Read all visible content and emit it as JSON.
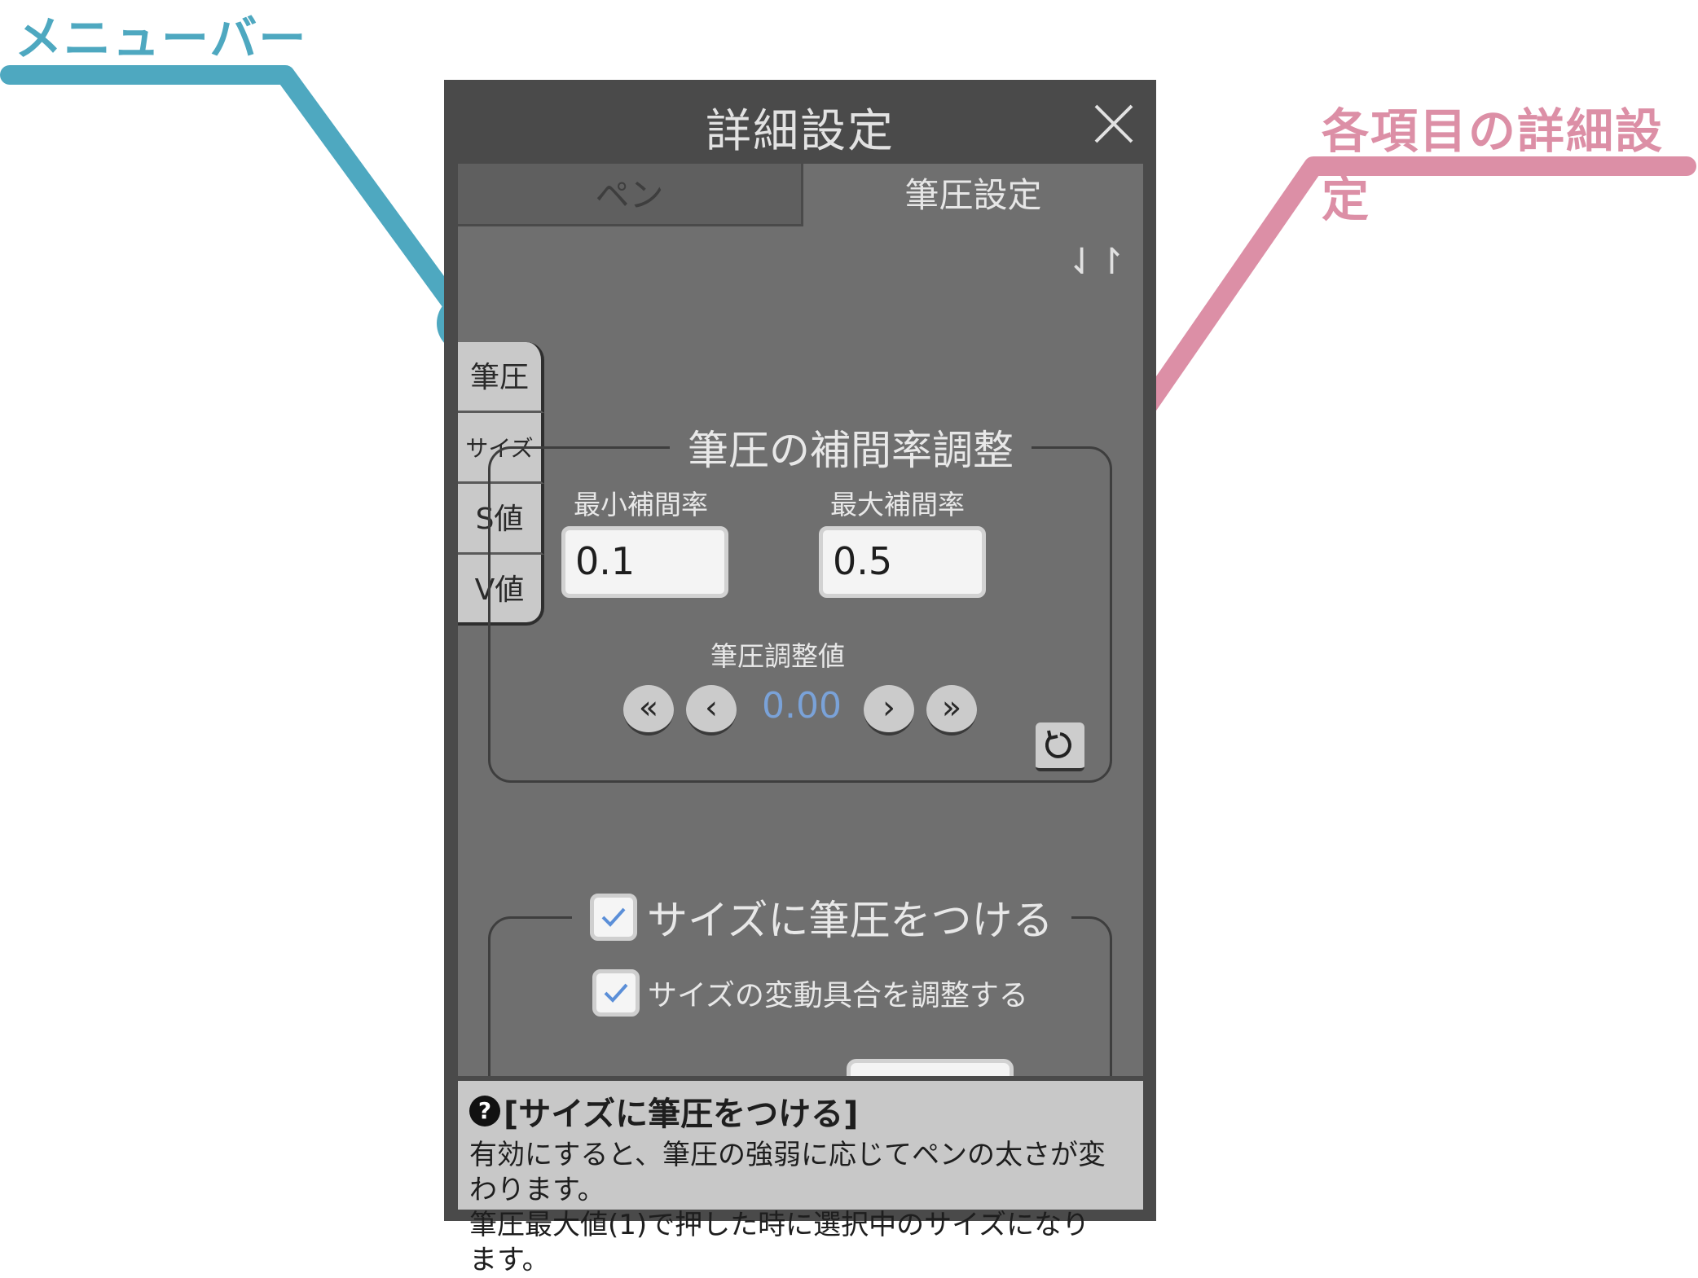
{
  "annotations": {
    "menubar_label": "メニューバー",
    "detail_label": "各項目の詳細設定",
    "menubar_color": "#4ea8c0",
    "detail_color": "#dc8fa6"
  },
  "dialog": {
    "title": "詳細設定",
    "close_icon": "close-icon",
    "tabs": [
      {
        "label": "ペン",
        "active": false
      },
      {
        "label": "筆圧設定",
        "active": true
      }
    ],
    "sort_icon": "⇃↾"
  },
  "side_menu": {
    "items": [
      {
        "label": "筆圧"
      },
      {
        "label": "サイズ"
      },
      {
        "label": "S値"
      },
      {
        "label": "V値"
      }
    ]
  },
  "pressure_group": {
    "title": "筆圧の補間率調整",
    "min_label": "最小補間率",
    "min_value": "0.1",
    "max_label": "最大補間率",
    "max_value": "0.5",
    "adjust_label": "筆圧調整値",
    "adjust_value": "0.00",
    "buttons": {
      "fast_prev": "«",
      "prev": "‹",
      "next": "›",
      "fast_next": "»"
    }
  },
  "size_group": {
    "checkbox_label": "サイズに筆圧をつける",
    "checked": true,
    "sub_checkbox_label": "サイズの変動具合を調整する",
    "sub_checked": true
  },
  "help": {
    "icon": "?",
    "title": "[サイズに筆圧をつける]",
    "lines": [
      "有効にすると、筆圧の強弱に応じてペンの太さが変",
      "わります。",
      "筆圧最大値(1)で押した時に選択中のサイズになり",
      "ます。"
    ]
  }
}
